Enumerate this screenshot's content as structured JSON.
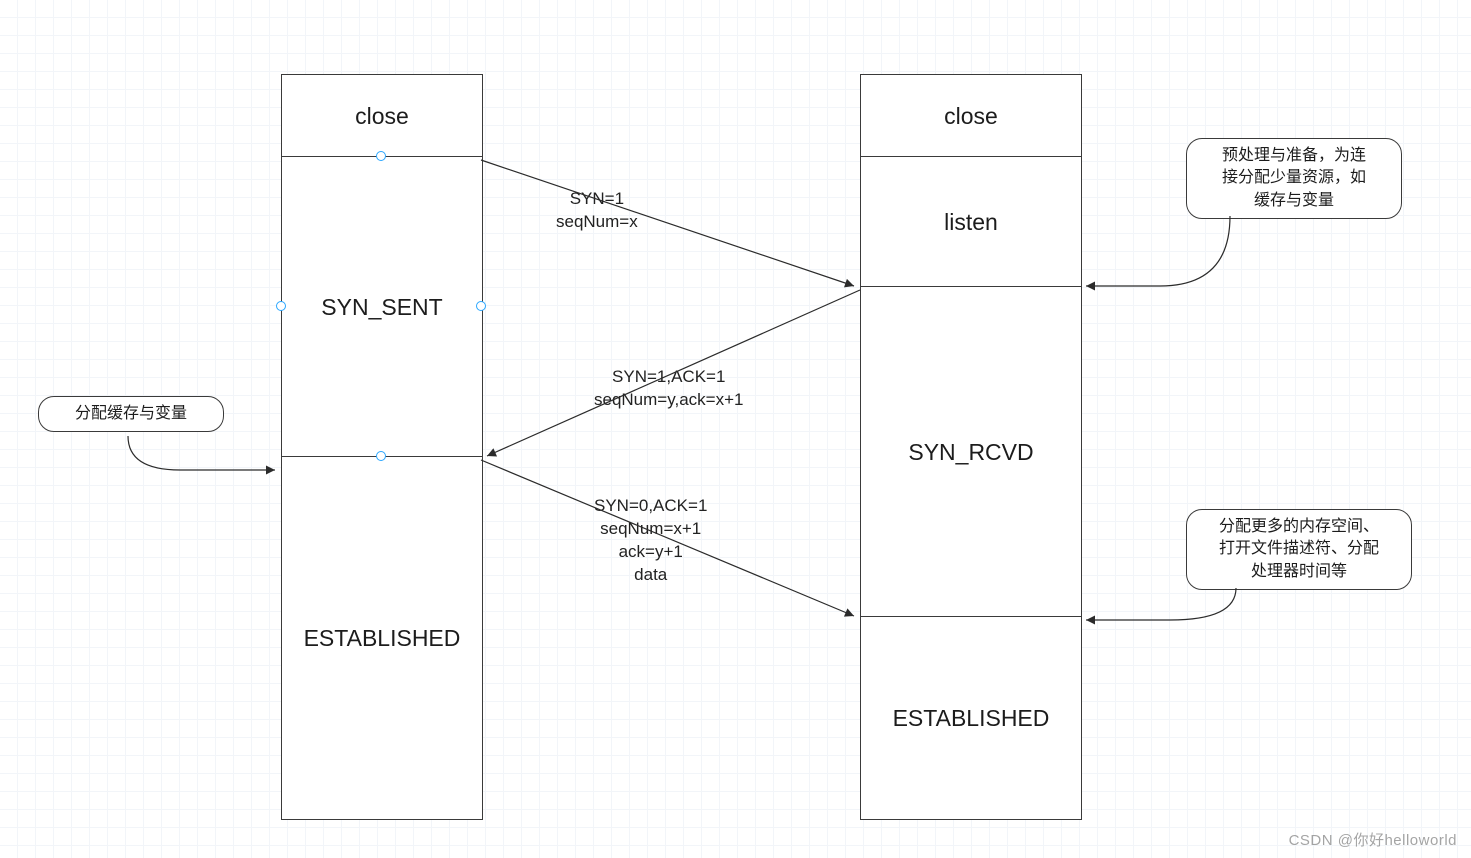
{
  "left": {
    "close": "close",
    "syn_sent": "SYN_SENT",
    "established": "ESTABLISHED"
  },
  "right": {
    "close": "close",
    "listen": "listen",
    "syn_rcvd": "SYN_RCVD",
    "established": "ESTABLISHED"
  },
  "messages": {
    "m1_l1": "SYN=1",
    "m1_l2": "seqNum=x",
    "m2_l1": "SYN=1,ACK=1",
    "m2_l2": "seqNum=y,ack=x+1",
    "m3_l1": "SYN=0,ACK=1",
    "m3_l2": "seqNum=x+1",
    "m3_l3": "ack=y+1",
    "m3_l4": "data"
  },
  "callouts": {
    "left1": "分配缓存与变量",
    "right1_l1": "预处理与准备，为连",
    "right1_l2": "接分配少量资源，如",
    "right1_l3": "缓存与变量",
    "right2_l1": "分配更多的内存空间、",
    "right2_l2": "打开文件描述符、分配",
    "right2_l3": "处理器时间等"
  },
  "watermark": "CSDN @你好helloworld"
}
